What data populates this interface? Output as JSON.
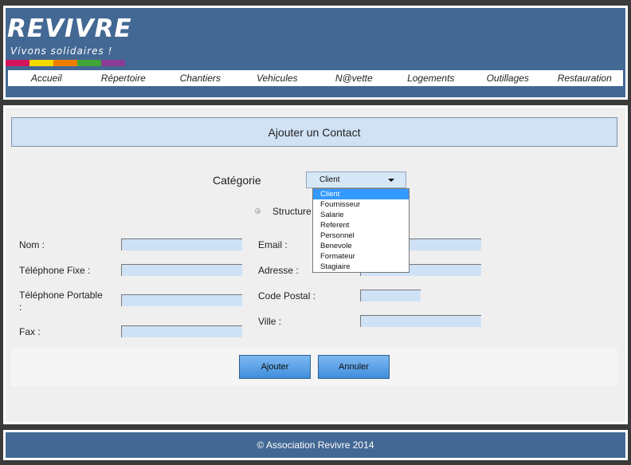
{
  "header": {
    "logo_text": "REVIVRE",
    "tagline": "Vivons solidaires !",
    "logo_bar_colors": [
      "#d4145a",
      "#f5d800",
      "#f07d00",
      "#3fa535",
      "#8c3c96"
    ],
    "nav": [
      "Accueil",
      "Répertoire",
      "Chantiers",
      "Vehicules",
      "N@vette",
      "Logements",
      "Outillages",
      "Restauration"
    ]
  },
  "form": {
    "title": "Ajouter un Contact",
    "categorie_label": "Catégorie",
    "categorie_value": "Client",
    "categorie_options": [
      "Client",
      "Fournisseur",
      "Salarie",
      "Referent",
      "Personnel",
      "Benevole",
      "Formateur",
      "Stagiaire"
    ],
    "structure_label": "Structure",
    "labels": {
      "nom": "Nom :",
      "tel_fixe": "Téléphone Fixe :",
      "tel_portable_1": "Téléphone Portable",
      "tel_portable_2": ":",
      "fax": "Fax :",
      "email": "Email :",
      "adresse": "Adresse :",
      "code_postal": "Code Postal :",
      "ville": "Ville :"
    },
    "values": {
      "nom": "",
      "tel_fixe": "",
      "tel_portable": "",
      "fax": "",
      "email": "",
      "adresse": "",
      "code_postal": "",
      "ville": ""
    },
    "buttons": {
      "ajouter": "Ajouter",
      "annuler": "Annuler"
    }
  },
  "footer": {
    "text": "© Association Revivre 2014"
  },
  "colors": {
    "header_bg": "#436894",
    "field_bg": "#cfe2f5",
    "button": "#5aa3ea",
    "selected_option": "#3399ff"
  }
}
